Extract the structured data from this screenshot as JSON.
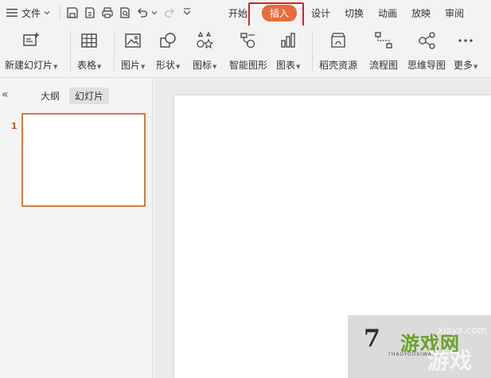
{
  "menubar": {
    "file_label": "文件",
    "tabs": [
      {
        "label": "开始"
      },
      {
        "label": "插入",
        "active": true
      },
      {
        "label": "设计"
      },
      {
        "label": "切换"
      },
      {
        "label": "动画"
      },
      {
        "label": "放映"
      },
      {
        "label": "审阅"
      }
    ]
  },
  "ribbon": {
    "new_slide": "新建幻灯片",
    "table": "表格",
    "picture": "图片",
    "shape": "形状",
    "icon": "图标",
    "smart_art": "智能图形",
    "chart": "图表",
    "docer": "稻壳资源",
    "flowchart": "流程图",
    "mindmap": "思维导图",
    "more": "更多"
  },
  "left_panel": {
    "collapse_glyph": "«",
    "outline_tab": "大纲",
    "slides_tab": "幻灯片",
    "slide_number": "1"
  },
  "watermark": {
    "seven": "7",
    "game_text": "游戏网",
    "pinyin": "7HAOYOUXIWANG",
    "url": "xiayx.com",
    "game_text_2": "游戏"
  },
  "colors": {
    "accent": "#e86b3c",
    "highlight": "#d32323",
    "thumb_border": "#d57a3f"
  }
}
